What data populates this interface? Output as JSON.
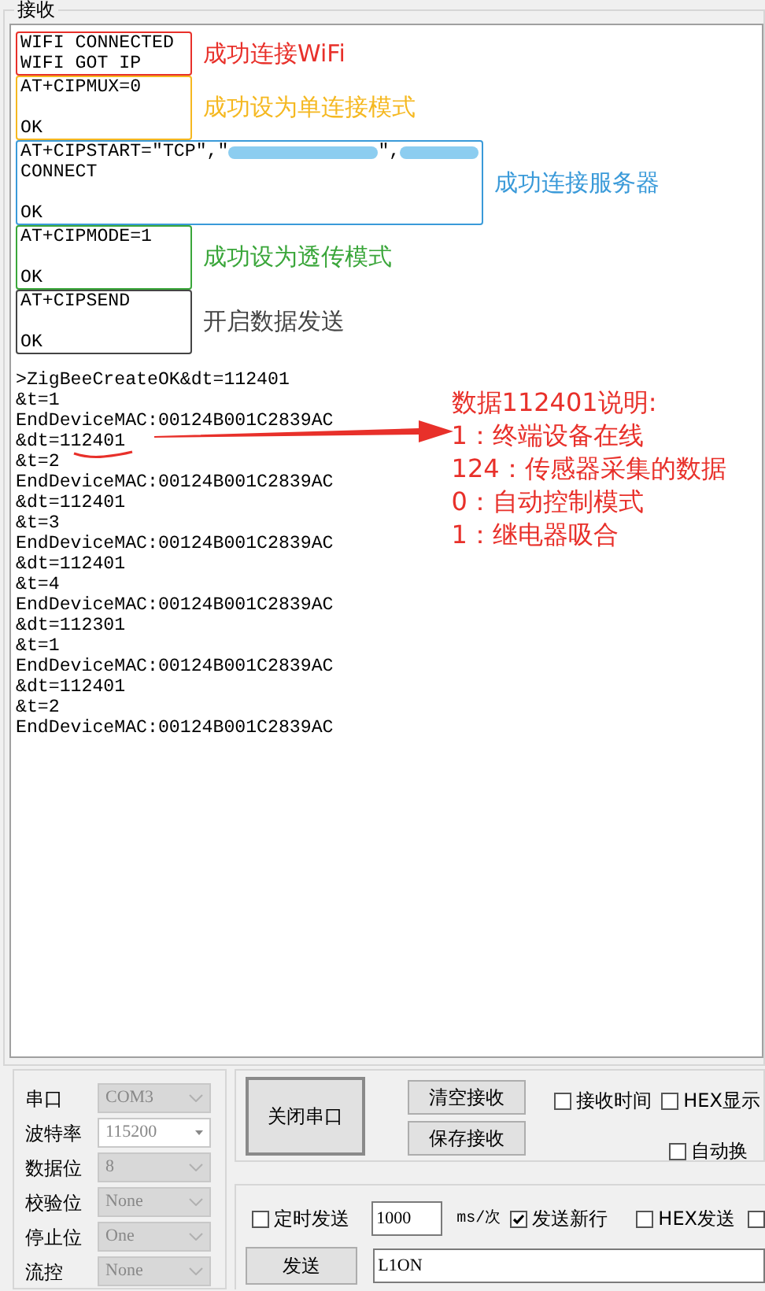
{
  "receive": {
    "title": "接收",
    "blocks": [
      {
        "lines": [
          "WIFI CONNECTED",
          "WIFI GOT IP"
        ],
        "color": "#e8302a",
        "note": "成功连接WiFi"
      },
      {
        "lines": [
          "AT+CIPMUX=0"
        ],
        "response": "OK",
        "color": "#f5b820",
        "note": "成功设为单连接模式"
      },
      {
        "lines": [
          [
            {
              "kind": "text",
              "text": "AT+CIPSTART=\"TCP\",\""
            },
            {
              "kind": "redaction"
            },
            {
              "kind": "text",
              "text": "\","
            },
            {
              "kind": "redaction"
            }
          ],
          "CONNECT"
        ],
        "response": "OK",
        "color": "#3a9ad9",
        "note": "成功连接服务器"
      },
      {
        "lines": [
          "AT+CIPMODE=1"
        ],
        "response": "OK",
        "color": "#3aa63a",
        "note": "成功设为透传模式"
      },
      {
        "lines": [
          "AT+CIPSEND"
        ],
        "response": "OK",
        "color": "#444444",
        "note": "开启数据发送"
      }
    ],
    "log": [
      ">ZigBeeCreateOK&dt=112401",
      "&t=1",
      "EndDeviceMAC:00124B001C2839AC",
      "&dt=112401",
      "&t=2",
      "EndDeviceMAC:00124B001C2839AC",
      "&dt=112401",
      "&t=3",
      "EndDeviceMAC:00124B001C2839AC",
      "&dt=112401",
      "&t=4",
      "EndDeviceMAC:00124B001C2839AC",
      "&dt=112301",
      "&t=1",
      "EndDeviceMAC:00124B001C2839AC",
      "&dt=112401",
      "&t=2",
      "EndDeviceMAC:00124B001C2839AC"
    ],
    "explanation": [
      "数据112401说明:",
      "1：终端设备在线",
      "124：传感器采集的数据",
      "0：自动控制模式",
      "1：继电器吸合"
    ]
  },
  "port_settings": [
    {
      "label": "串口",
      "value": "COM3",
      "disabled": true
    },
    {
      "label": "波特率",
      "value": "115200",
      "disabled": false
    },
    {
      "label": "数据位",
      "value": "8",
      "disabled": true
    },
    {
      "label": "校验位",
      "value": "None",
      "disabled": true
    },
    {
      "label": "停止位",
      "value": "One",
      "disabled": true
    },
    {
      "label": "流控",
      "value": "None",
      "disabled": true
    }
  ],
  "port_button": "关闭串口",
  "receive_buttons": [
    "清空接收",
    "保存接收"
  ],
  "receive_options": [
    {
      "label": "接收时间",
      "checked": false
    },
    {
      "label": "HEX显示",
      "checked": false
    },
    {
      "label": "自动换",
      "checked": false
    }
  ],
  "send_options": {
    "timed": {
      "label": "定时发送",
      "checked": false
    },
    "interval": "1000",
    "unit": "ms/次",
    "newline": {
      "label": "发送新行",
      "checked": true
    },
    "hex": {
      "label": "HEX发送",
      "checked": false
    },
    "extra": {
      "checked": false
    }
  },
  "send_button": "发送",
  "send_text": "L1ON"
}
